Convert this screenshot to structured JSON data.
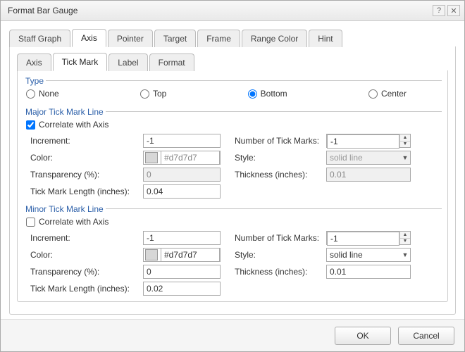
{
  "dialog": {
    "title": "Format Bar Gauge"
  },
  "primaryTabs": {
    "t0": "Staff Graph",
    "t1": "Axis",
    "t2": "Pointer",
    "t3": "Target",
    "t4": "Frame",
    "t5": "Range Color",
    "t6": "Hint"
  },
  "subTabs": {
    "s0": "Axis",
    "s1": "Tick Mark",
    "s2": "Label",
    "s3": "Format"
  },
  "typeGroup": {
    "legend": "Type",
    "options": {
      "none": "None",
      "top": "Top",
      "bottom": "Bottom",
      "center": "Center"
    }
  },
  "major": {
    "legend": "Major Tick Mark Line",
    "correlate": "Correlate with Axis",
    "incrementLabel": "Increment:",
    "incrementValue": "-1",
    "numTicksLabel": "Number of Tick Marks:",
    "numTicksValue": "-1",
    "colorLabel": "Color:",
    "colorValue": "#d7d7d7",
    "styleLabel": "Style:",
    "styleValue": "solid line",
    "transLabel": "Transparency (%):",
    "transValue": "0",
    "thickLabel": "Thickness (inches):",
    "thickValue": "0.01",
    "lenLabel": "Tick Mark Length (inches):",
    "lenValue": "0.04"
  },
  "minor": {
    "legend": "Minor Tick Mark Line",
    "correlate": "Correlate with Axis",
    "incrementLabel": "Increment:",
    "incrementValue": "-1",
    "numTicksLabel": "Number of Tick Marks:",
    "numTicksValue": "-1",
    "colorLabel": "Color:",
    "colorValue": "#d7d7d7",
    "styleLabel": "Style:",
    "styleValue": "solid line",
    "transLabel": "Transparency (%):",
    "transValue": "0",
    "thickLabel": "Thickness (inches):",
    "thickValue": "0.01",
    "lenLabel": "Tick Mark Length (inches):",
    "lenValue": "0.02"
  },
  "footer": {
    "ok": "OK",
    "cancel": "Cancel"
  }
}
